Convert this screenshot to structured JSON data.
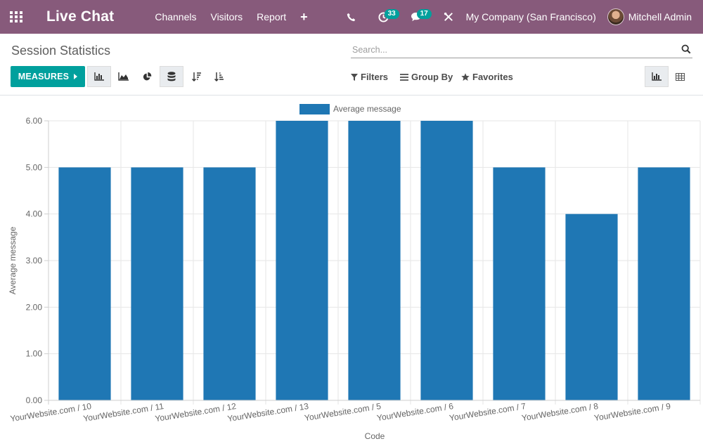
{
  "navbar": {
    "app_title": "Live Chat",
    "menu": [
      "Channels",
      "Visitors",
      "Report"
    ],
    "plus": "+",
    "activity_badge": "33",
    "messages_badge": "17",
    "company": "My Company (San Francisco)",
    "user_name": "Mitchell Admin",
    "bg_color": "#875a7b"
  },
  "control_panel": {
    "breadcrumb": "Session Statistics",
    "search_placeholder": "Search...",
    "measures_label": "MEASURES",
    "filters_label": "Filters",
    "group_by_label": "Group By",
    "favorites_label": "Favorites",
    "accent_color": "#00a09d"
  },
  "chart_data": {
    "type": "bar",
    "categories": [
      "YourWebsite.com / 10",
      "YourWebsite.com / 11",
      "YourWebsite.com / 12",
      "YourWebsite.com / 13",
      "YourWebsite.com / 5",
      "YourWebsite.com / 6",
      "YourWebsite.com / 7",
      "YourWebsite.com / 8",
      "YourWebsite.com / 9"
    ],
    "series": [
      {
        "name": "Average message",
        "values": [
          5,
          5,
          5,
          6,
          6,
          6,
          5,
          4,
          5
        ],
        "color": "#1f77b4"
      }
    ],
    "xlabel": "Code",
    "ylabel": "Average message",
    "ylim": [
      0,
      6
    ],
    "yticks": [
      "0.00",
      "1.00",
      "2.00",
      "3.00",
      "4.00",
      "5.00",
      "6.00"
    ],
    "grid": true,
    "legend": "top-center"
  }
}
